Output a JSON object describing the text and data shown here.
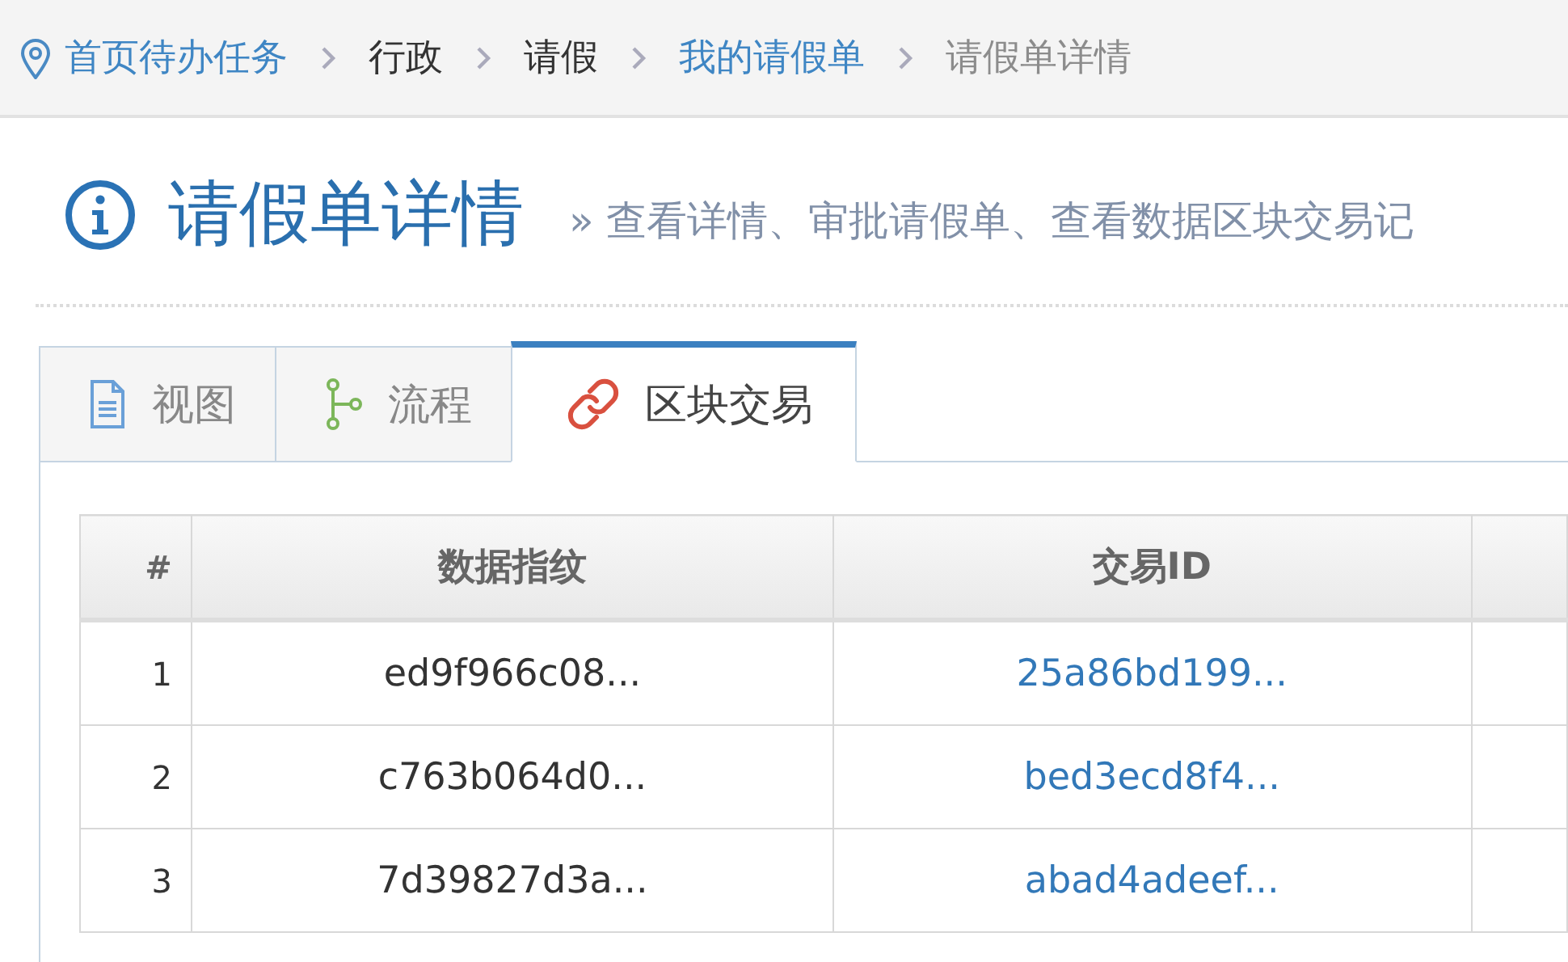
{
  "breadcrumb": [
    {
      "label": "首页待办任务",
      "kind": "link"
    },
    {
      "label": "行政",
      "kind": "text"
    },
    {
      "label": "请假",
      "kind": "text"
    },
    {
      "label": "我的请假单",
      "kind": "link"
    },
    {
      "label": "请假单详情",
      "kind": "current"
    }
  ],
  "page_header": {
    "title": "请假单详情",
    "subtitle": "» 查看详情、审批请假单、查看数据区块交易记"
  },
  "tabs": [
    {
      "label": "视图",
      "selected": false
    },
    {
      "label": "流程",
      "selected": false
    },
    {
      "label": "区块交易",
      "selected": true
    }
  ],
  "table": {
    "columns": [
      "#",
      "数据指纹",
      "交易ID"
    ],
    "rows": [
      {
        "index": "1",
        "fingerprint": "ed9f966c08...",
        "transaction_id": "25a86bd199..."
      },
      {
        "index": "2",
        "fingerprint": "c763b064d0...",
        "transaction_id": "bed3ecd8f4..."
      },
      {
        "index": "3",
        "fingerprint": "7d39827d3a...",
        "transaction_id": "abad4adeef..."
      }
    ]
  }
}
